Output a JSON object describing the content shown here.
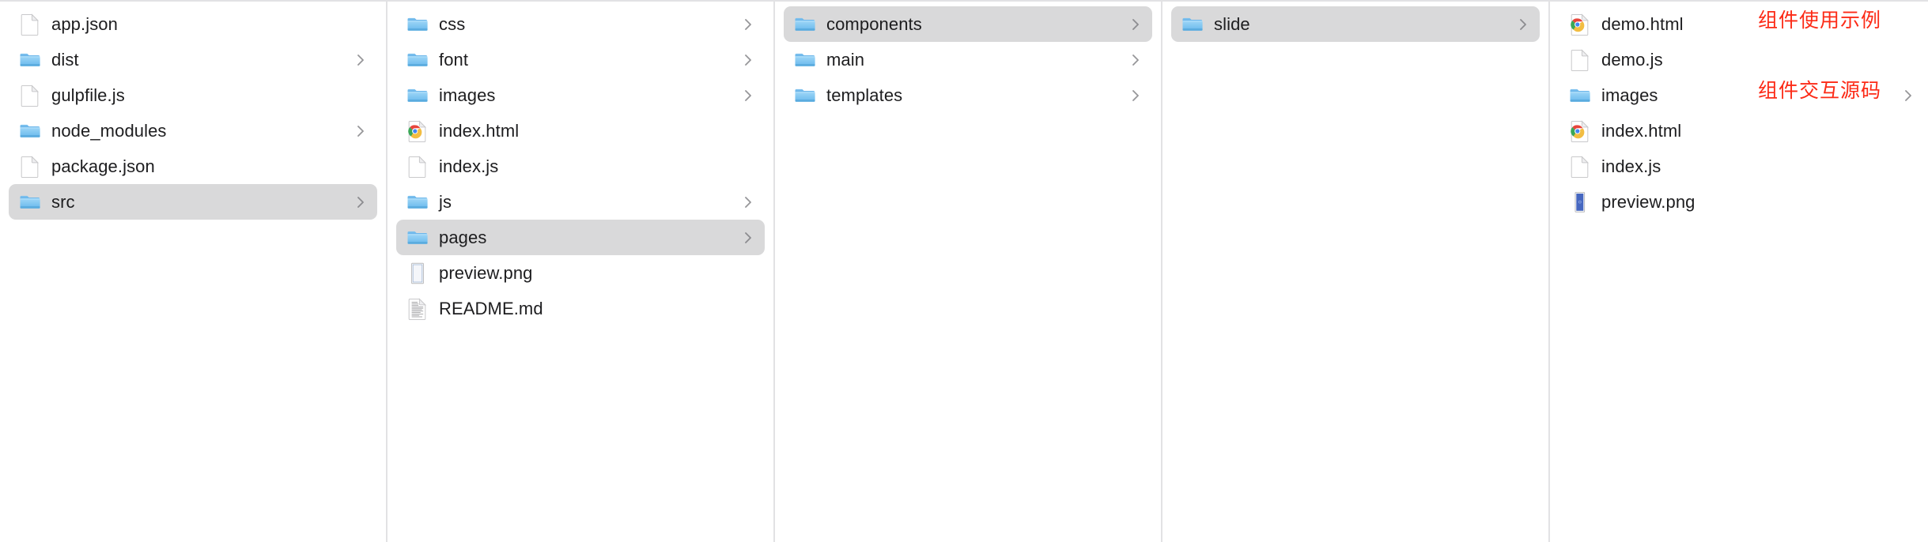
{
  "window": {
    "view": "column-view",
    "accent_selection_color": "#d9d9da",
    "divider_color": "#e2e2e4",
    "text_color": "#1d1d1f",
    "annotation_color": "#fc2a16"
  },
  "columns": [
    {
      "name": "column-1",
      "items": [
        {
          "label": "app.json",
          "icon": "blank-document-icon",
          "has_chevron": false,
          "selected": false
        },
        {
          "label": "dist",
          "icon": "folder-icon",
          "has_chevron": true,
          "selected": false
        },
        {
          "label": "gulpfile.js",
          "icon": "blank-document-icon",
          "has_chevron": false,
          "selected": false
        },
        {
          "label": "node_modules",
          "icon": "folder-icon",
          "has_chevron": true,
          "selected": false
        },
        {
          "label": "package.json",
          "icon": "blank-document-icon",
          "has_chevron": false,
          "selected": false
        },
        {
          "label": "src",
          "icon": "folder-icon",
          "has_chevron": true,
          "selected": true
        }
      ]
    },
    {
      "name": "column-2",
      "items": [
        {
          "label": "css",
          "icon": "folder-icon",
          "has_chevron": true,
          "selected": false
        },
        {
          "label": "font",
          "icon": "folder-icon",
          "has_chevron": true,
          "selected": false
        },
        {
          "label": "images",
          "icon": "folder-icon",
          "has_chevron": true,
          "selected": false
        },
        {
          "label": "index.html",
          "icon": "chrome-html-icon",
          "has_chevron": false,
          "selected": false
        },
        {
          "label": "index.js",
          "icon": "blank-document-icon",
          "has_chevron": false,
          "selected": false
        },
        {
          "label": "js",
          "icon": "folder-icon",
          "has_chevron": true,
          "selected": false
        },
        {
          "label": "pages",
          "icon": "folder-icon",
          "has_chevron": true,
          "selected": true
        },
        {
          "label": "preview.png",
          "icon": "image-preview-icon",
          "has_chevron": false,
          "selected": false
        },
        {
          "label": "README.md",
          "icon": "text-document-icon",
          "has_chevron": false,
          "selected": false
        }
      ]
    },
    {
      "name": "column-3",
      "items": [
        {
          "label": "components",
          "icon": "folder-icon",
          "has_chevron": true,
          "selected": true
        },
        {
          "label": "main",
          "icon": "folder-icon",
          "has_chevron": true,
          "selected": false
        },
        {
          "label": "templates",
          "icon": "folder-icon",
          "has_chevron": true,
          "selected": false
        }
      ]
    },
    {
      "name": "column-4",
      "items": [
        {
          "label": "slide",
          "icon": "folder-icon",
          "has_chevron": true,
          "selected": true
        }
      ]
    },
    {
      "name": "column-5",
      "items": [
        {
          "label": "demo.html",
          "icon": "chrome-html-icon",
          "has_chevron": false,
          "selected": false
        },
        {
          "label": "demo.js",
          "icon": "blank-document-icon",
          "has_chevron": false,
          "selected": false
        },
        {
          "label": "images",
          "icon": "folder-icon",
          "has_chevron": true,
          "selected": false
        },
        {
          "label": "index.html",
          "icon": "chrome-html-icon",
          "has_chevron": false,
          "selected": false
        },
        {
          "label": "index.js",
          "icon": "blank-document-icon",
          "has_chevron": false,
          "selected": false
        },
        {
          "label": "preview.png",
          "icon": "blue-thumbnail-icon",
          "has_chevron": false,
          "selected": false
        }
      ]
    }
  ],
  "annotations": [
    {
      "name": "annotation-demo-html",
      "text": "组件使用示例"
    },
    {
      "name": "annotation-index-html",
      "text": "组件交互源码"
    }
  ]
}
